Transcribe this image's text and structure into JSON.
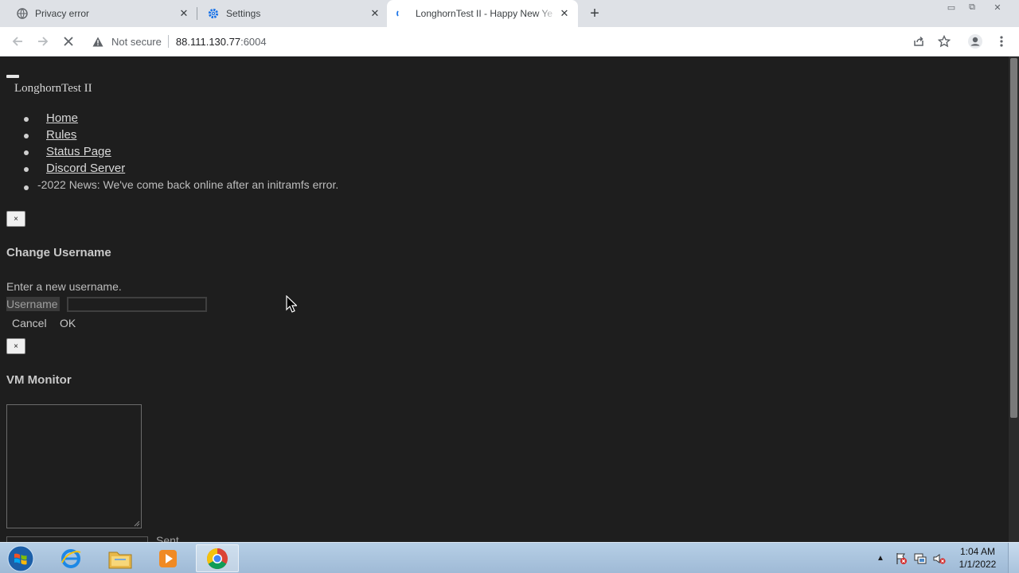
{
  "browser": {
    "tabs": [
      {
        "title": "Privacy error",
        "icon": "warning-globe-icon",
        "active": false
      },
      {
        "title": "Settings",
        "icon": "gear-icon",
        "active": false
      },
      {
        "title": "LonghornTest II - Happy New Ye",
        "icon": "loading-spinner-icon",
        "active": true
      }
    ],
    "new_tab_label": "+",
    "security_label": "Not secure",
    "url_host": "88.111.130.77",
    "url_port": ":6004"
  },
  "page": {
    "brand": "LonghornTest II",
    "nav_items": [
      "Home",
      "Rules",
      "Status Page",
      "Discord Server"
    ],
    "news": "-2022 News: We've come back online after an initramfs error.",
    "close_glyph": "×",
    "change_username": {
      "heading": "Change Username",
      "prompt": "Enter a new username.",
      "field_label": "Username",
      "field_value": "",
      "cancel_label": "Cancel",
      "ok_label": "OK"
    },
    "vm_monitor": {
      "heading": "VM Monitor",
      "send_peek": "Sent"
    }
  },
  "taskbar": {
    "apps": [
      "Internet Explorer",
      "Windows Explorer",
      "Windows Media Player",
      "Google Chrome"
    ],
    "active_app": "Google Chrome",
    "time": "1:04 AM",
    "date": "1/1/2022"
  },
  "colors": {
    "page_bg": "#1e1e1e",
    "tabstrip_bg": "#dee1e6",
    "taskbar_bg": "#a9c2dc",
    "settings_gear": "#1a73e8"
  }
}
